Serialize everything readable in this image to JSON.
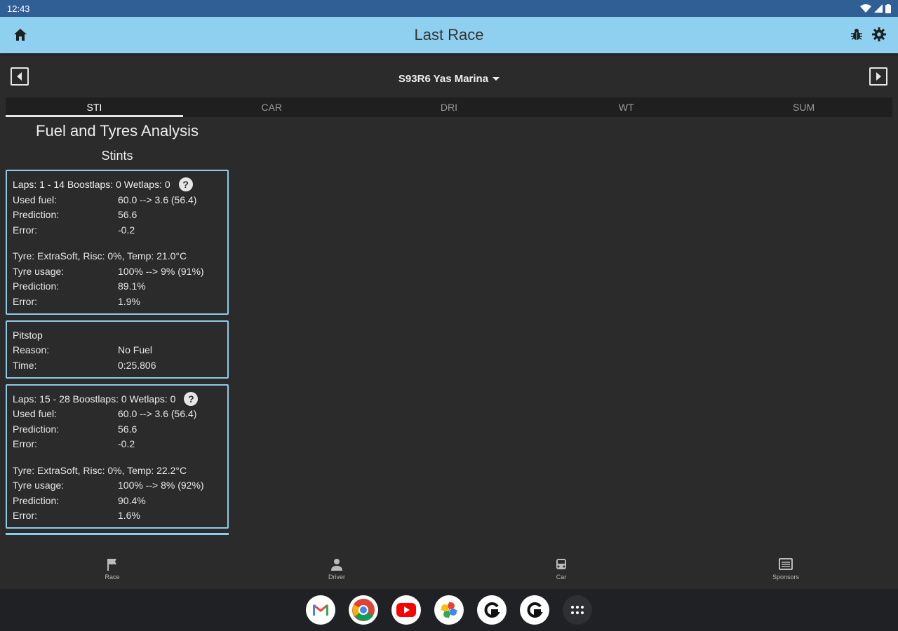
{
  "status": {
    "time": "12:43"
  },
  "appbar": {
    "title": "Last Race"
  },
  "race": {
    "selected": "S93R6 Yas Marina"
  },
  "tabs": [
    {
      "label": "STI",
      "active": true
    },
    {
      "label": "CAR",
      "active": false
    },
    {
      "label": "DRI",
      "active": false
    },
    {
      "label": "WT",
      "active": false
    },
    {
      "label": "SUM",
      "active": false
    }
  ],
  "content": {
    "title": "Fuel and Tyres Analysis",
    "section": "Stints",
    "stint1": {
      "header": "Laps: 1 - 14  Boostlaps: 0  Wetlaps: 0",
      "fuel": [
        {
          "k": "Used fuel:",
          "v": "60.0 --> 3.6 (56.4)"
        },
        {
          "k": "Prediction:",
          "v": "56.6"
        },
        {
          "k": "Error:",
          "v": "-0.2"
        }
      ],
      "tyre_line": "Tyre: ExtraSoft, Risc: 0%, Temp: 21.0°C",
      "tyre": [
        {
          "k": "Tyre usage:",
          "v": "100% --> 9% (91%)"
        },
        {
          "k": "Prediction:",
          "v": "89.1%"
        },
        {
          "k": "Error:",
          "v": "1.9%"
        }
      ]
    },
    "pitstop": {
      "header": "Pitstop",
      "rows": [
        {
          "k": "Reason:",
          "v": "No Fuel"
        },
        {
          "k": "Time:",
          "v": "0:25.806"
        }
      ]
    },
    "stint2": {
      "header": "Laps: 15 - 28  Boostlaps: 0  Wetlaps: 0",
      "fuel": [
        {
          "k": "Used fuel:",
          "v": "60.0 --> 3.6 (56.4)"
        },
        {
          "k": "Prediction:",
          "v": "56.6"
        },
        {
          "k": "Error:",
          "v": "-0.2"
        }
      ],
      "tyre_line": "Tyre: ExtraSoft, Risc: 0%, Temp: 22.2°C",
      "tyre": [
        {
          "k": "Tyre usage:",
          "v": "100% --> 8% (92%)"
        },
        {
          "k": "Prediction:",
          "v": "90.4%"
        },
        {
          "k": "Error:",
          "v": "1.6%"
        }
      ]
    }
  },
  "bottom_nav": [
    {
      "label": "Race",
      "icon": "flag-icon"
    },
    {
      "label": "Driver",
      "icon": "person-icon"
    },
    {
      "label": "Car",
      "icon": "car-icon"
    },
    {
      "label": "Sponsors",
      "icon": "sponsors-icon"
    }
  ],
  "dock": [
    "gmail-icon",
    "chrome-icon",
    "youtube-icon",
    "photos-icon",
    "app-icon",
    "app-icon",
    "app-drawer-icon"
  ]
}
